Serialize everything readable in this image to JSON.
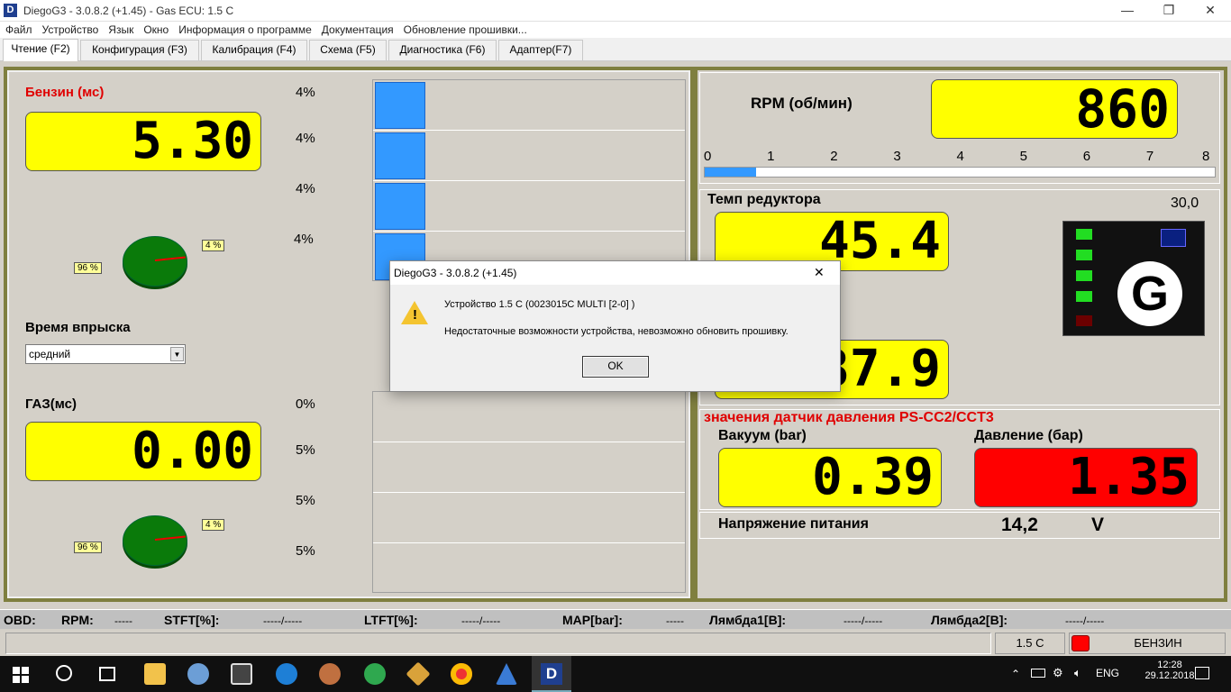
{
  "window": {
    "title": "DiegoG3 - 3.0.8.2 (+1.45) - Gas ECU: 1.5 C",
    "logo": "D",
    "min": "—",
    "max": "❐",
    "close": "✕"
  },
  "menu": [
    "Файл",
    "Устройство",
    "Язык",
    "Окно",
    "Информация о программе",
    "Документация",
    "Обновление прошивки..."
  ],
  "tabs": [
    "Чтение (F2)",
    "Конфигурация (F3)",
    "Калибрация (F4)",
    "Схема (F5)",
    "Диагностика (F6)",
    "Адаптер(F7)"
  ],
  "petrol": {
    "label": "Бензин (мс)",
    "value": "5.30",
    "pie_big": "96 %",
    "pie_small": "4 %"
  },
  "petrol_bars": [
    {
      "pct": "4%",
      "fill": 0.04
    },
    {
      "pct": "4%",
      "fill": 0.04
    },
    {
      "pct": "4%",
      "fill": 0.04
    },
    {
      "pct": "4%",
      "fill": 0.04
    }
  ],
  "injection": {
    "label": "Время впрыска",
    "selected": "средний"
  },
  "gas": {
    "label": "ГАЗ(мс)",
    "value": "0.00",
    "pie_big": "96 %",
    "pie_small": "4 %"
  },
  "gas_bars": [
    {
      "pct": "0%",
      "fill": 0
    },
    {
      "pct": "5%",
      "fill": 0
    },
    {
      "pct": "5%",
      "fill": 0
    },
    {
      "pct": "5%",
      "fill": 0
    }
  ],
  "rpm": {
    "label": "RPM (об/мин)",
    "value": "860",
    "scale": [
      "0",
      "1",
      "2",
      "3",
      "4",
      "5",
      "6",
      "7",
      "8"
    ],
    "level": 0.1
  },
  "reducer": {
    "label": "Темп редуктора",
    "value": "45.4",
    "value2": "37.9",
    "reading": "30,0"
  },
  "sensor": {
    "title": "значения датчик давления PS-CC2/CCT3",
    "vacuum_label": "Вакуум (bar)",
    "vacuum": "0.39",
    "pressure_label": "Давление (бар)",
    "pressure": "1.35"
  },
  "voltage": {
    "label": "Напряжение питания",
    "value": "14,2",
    "unit": "V"
  },
  "indicator": {
    "letter": "G"
  },
  "obd": {
    "obd": "OBD:",
    "rpm": "RPM:",
    "rpm_v": "-----",
    "stft": "STFT[%]:",
    "stft_v": "-----/-----",
    "ltft": "LTFT[%]:",
    "ltft_v": "-----/-----",
    "map": "MAP[bar]:",
    "map_v": "-----",
    "l1": "Лямбда1[В]:",
    "l1_v": "-----/-----",
    "l2": "Лямбда2[В]:",
    "l2_v": "-----/-----"
  },
  "status": {
    "device": "1.5 C",
    "fuel": "БЕНЗИН"
  },
  "dialog": {
    "title": "DiegoG3 - 3.0.8.2 (+1.45)",
    "line1": "Устройство 1.5 C (0023015C MULTI [2-0] )",
    "line2": "Недостаточные возможности устройства, невозможно обновить прошивку.",
    "ok": "OK",
    "close": "✕"
  },
  "tray": {
    "lang": "ENG",
    "time": "12:28",
    "date": "29.12.2018"
  },
  "colors": {
    "lcd": "#ffff00",
    "alarm": "#ff0000",
    "bar": "#3399ff"
  }
}
